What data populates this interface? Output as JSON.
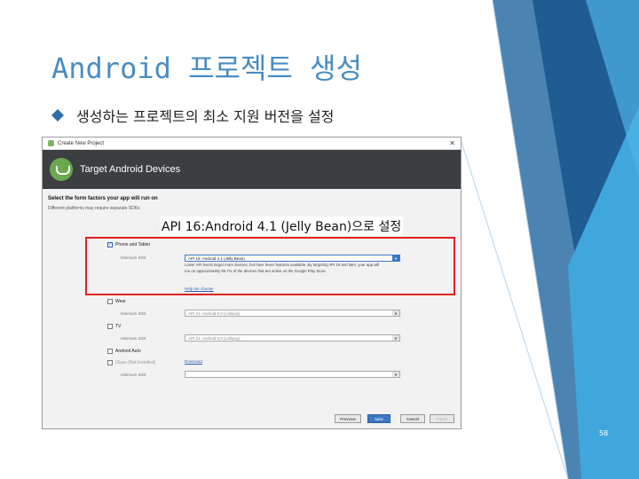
{
  "slide": {
    "title": "Android 프로젝트 생성",
    "bullet": "생성하는 프로젝트의 최소 지원 버전을 설정",
    "callout": "API 16:Android 4.1 (Jelly Bean)으로 설정",
    "page_number": "58",
    "accent_color": "#4a8dc2",
    "highlight_color": "#e02020"
  },
  "dialog": {
    "window_title": "Create New Project",
    "close_icon": "close-icon",
    "banner_title": "Target Android Devices",
    "heading": "Select the form factors your app will run on",
    "subheading": "Different platforms may require separate SDKs",
    "form_factors": [
      {
        "label": "Phone and Tablet",
        "checked": true,
        "min_label": "Minimum SDK",
        "sdk": "API 16: Android 4.1 (Jelly Bean)"
      },
      {
        "label": "Wear",
        "checked": false,
        "min_label": "Minimum SDK",
        "sdk": "API 21: Android 5.0 (Lollipop)"
      },
      {
        "label": "TV",
        "checked": false,
        "min_label": "Minimum SDK",
        "sdk": "API 21: Android 5.0 (Lollipop)"
      },
      {
        "label": "Android Auto",
        "checked": false
      },
      {
        "label": "Glass (Not Installed)",
        "checked": false,
        "min_label": "Minimum SDK",
        "sdk": ""
      }
    ],
    "description": "Lower API levels target more devices, but have fewer features available. By targeting API 16 and later, your app will run on approximately 86.7% of the devices that are active on the Google Play Store.",
    "help_link": "Help me choose",
    "download_link": "Download",
    "buttons": {
      "previous": "Previous",
      "next": "Next",
      "cancel": "Cancel",
      "finish": "Finish"
    }
  }
}
